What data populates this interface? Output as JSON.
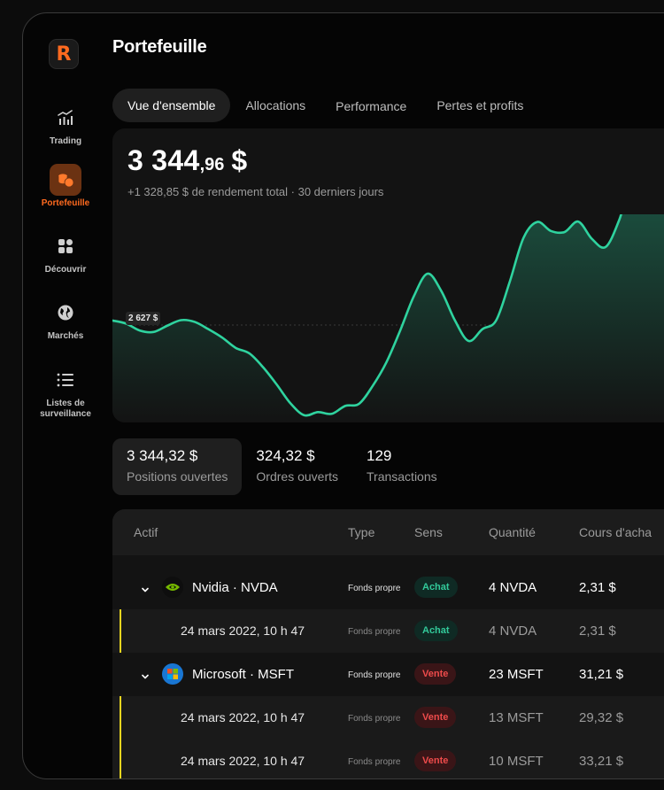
{
  "app": {
    "logo_letter": "R",
    "accent": "#ff6a1f",
    "title": "Portefeuille"
  },
  "sidebar": {
    "items": [
      {
        "label": "Trading",
        "icon": "chart-bars-icon",
        "active": false
      },
      {
        "label": "Portefeuille",
        "icon": "coins-icon",
        "active": true
      },
      {
        "label": "Découvrir",
        "icon": "grid-icon",
        "active": false
      },
      {
        "label": "Marchés",
        "icon": "globe-icon",
        "active": false
      },
      {
        "label": "Listes de surveillance",
        "label_line1": "Listes de",
        "label_line2": "surveillance",
        "icon": "list-icon",
        "active": false
      }
    ]
  },
  "tabs": [
    {
      "label": "Vue d'ensemble",
      "active": true
    },
    {
      "label": "Allocations",
      "active": false
    },
    {
      "label": "Performance",
      "active": false
    },
    {
      "label": "Pertes et profits",
      "active": false
    }
  ],
  "summary": {
    "value_main": "3 344",
    "value_decimals": ",96",
    "currency": "$",
    "subtitle": "+1 328,85 $ de rendement total · 30 derniers jours",
    "reference_label": "2 627 $"
  },
  "chart_data": {
    "type": "line",
    "x_range": [
      0,
      1
    ],
    "reference_value": 2627,
    "line_color": "#2fd39f",
    "values": [
      2640,
      2631,
      2611,
      2607,
      2625,
      2641,
      2636,
      2615,
      2591,
      2561,
      2545,
      2505,
      2455,
      2401,
      2367,
      2376,
      2371,
      2394,
      2400,
      2452,
      2520,
      2611,
      2710,
      2775,
      2725,
      2640,
      2581,
      2615,
      2640,
      2752,
      2878,
      2924,
      2898,
      2895,
      2925,
      2875,
      2852,
      2931,
      3051,
      3000,
      2969,
      3136,
      3030
    ],
    "area_gradient": [
      "#1d5d49",
      "#131313"
    ]
  },
  "stats": [
    {
      "value": "3 344,32 $",
      "label": "Positions ouvertes",
      "active": true
    },
    {
      "value": "324,32 $",
      "label": "Ordres ouverts",
      "active": false
    },
    {
      "value": "129",
      "label": "Transactions",
      "active": false
    }
  ],
  "table": {
    "headers": [
      "Actif",
      "Type",
      "Sens",
      "Quantité",
      "Cours d'acha"
    ],
    "rows": [
      {
        "kind": "parent",
        "name": "Nvidia · NVDA",
        "icon": "nvidia-icon",
        "type": "Fonds propre",
        "side": "Achat",
        "side_kind": "buy",
        "qty": "4 NVDA",
        "price": "2,31 $"
      },
      {
        "kind": "child",
        "name": "24 mars 2022, 10 h 47",
        "type": "Fonds propre",
        "side": "Achat",
        "side_kind": "buy",
        "qty": "4 NVDA",
        "price": "2,31 $"
      },
      {
        "kind": "parent",
        "name": "Microsoft · MSFT",
        "icon": "microsoft-icon",
        "type": "Fonds propre",
        "side": "Vente",
        "side_kind": "sell",
        "qty": "23 MSFT",
        "price": "31,21 $"
      },
      {
        "kind": "child",
        "name": "24 mars 2022, 10 h 47",
        "type": "Fonds propre",
        "side": "Vente",
        "side_kind": "sell",
        "qty": "13 MSFT",
        "price": "29,32 $"
      },
      {
        "kind": "child",
        "name": "24 mars 2022, 10 h 47",
        "type": "Fonds propre",
        "side": "Vente",
        "side_kind": "sell",
        "qty": "10 MSFT",
        "price": "33,21 $"
      }
    ]
  }
}
